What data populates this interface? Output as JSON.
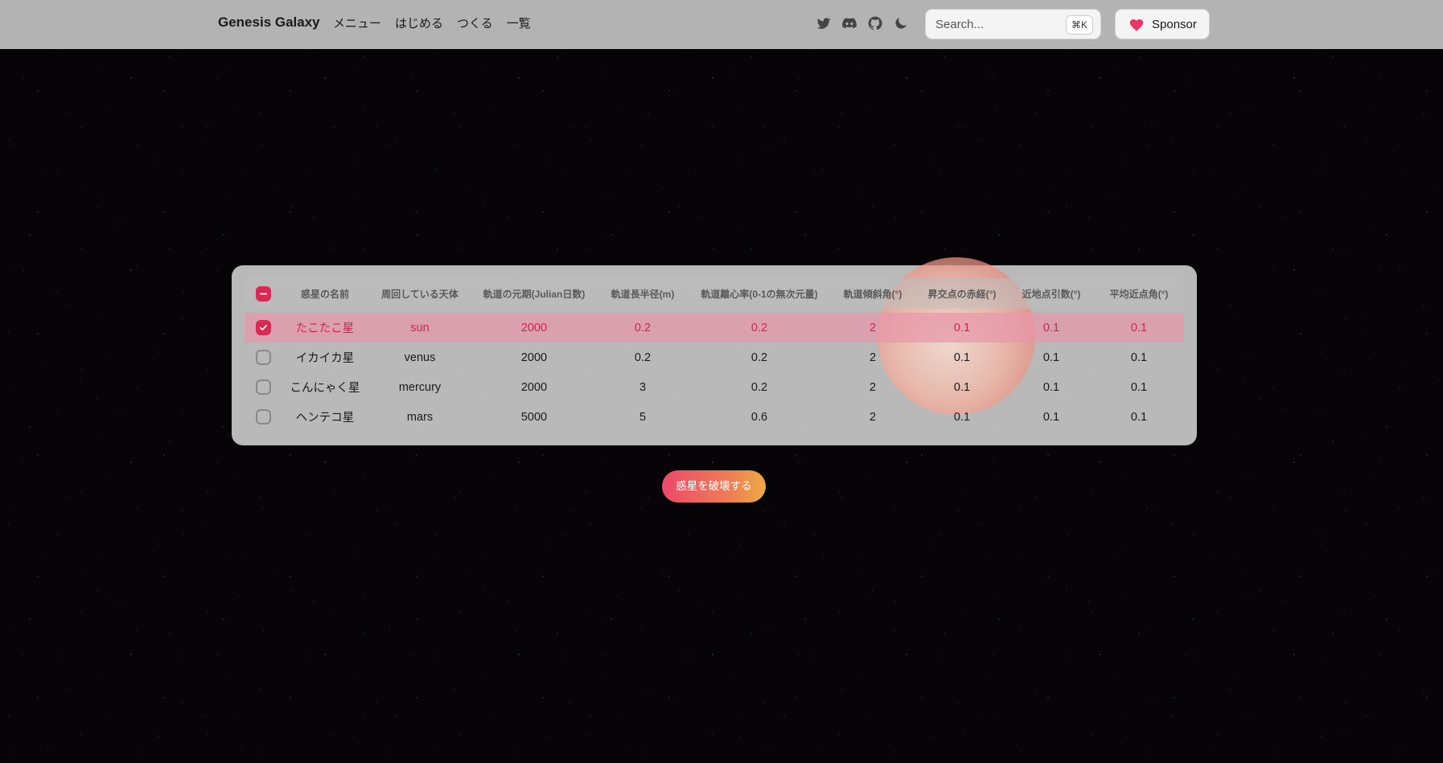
{
  "navbar": {
    "brand": "Genesis Galaxy",
    "links": [
      "メニュー",
      "はじめる",
      "つくる",
      "一覧"
    ],
    "icons": [
      "twitter-icon",
      "discord-icon",
      "github-icon",
      "moon-icon"
    ],
    "search_placeholder": "Search...",
    "search_shortcut": "⌘K",
    "sponsor_label": "Sponsor"
  },
  "table": {
    "headers": [
      "惑星の名前",
      "周回している天体",
      "軌道の元期(Julian日数)",
      "軌道長半径(m)",
      "軌道離心率(0-1の無次元量)",
      "軌道傾斜角(°)",
      "昇交点の赤経(°)",
      "近地点引数(°)",
      "平均近点角(°)"
    ],
    "rows": [
      {
        "selected": true,
        "cells": [
          "たこたこ星",
          "sun",
          "2000",
          "0.2",
          "0.2",
          "2",
          "0.1",
          "0.1",
          "0.1"
        ]
      },
      {
        "selected": false,
        "cells": [
          "イカイカ星",
          "venus",
          "2000",
          "0.2",
          "0.2",
          "2",
          "0.1",
          "0.1",
          "0.1"
        ]
      },
      {
        "selected": false,
        "cells": [
          "こんにゃく星",
          "mercury",
          "2000",
          "3",
          "0.2",
          "2",
          "0.1",
          "0.1",
          "0.1"
        ]
      },
      {
        "selected": false,
        "cells": [
          "ヘンテコ星",
          "mars",
          "5000",
          "5",
          "0.6",
          "2",
          "0.1",
          "0.1",
          "0.1"
        ]
      }
    ]
  },
  "actions": {
    "destroy_label": "惑星を破壊する"
  },
  "colors": {
    "accent": "#d92a56",
    "navbar": "#b3b3b3",
    "button_gradient_start": "#ec4a6a",
    "button_gradient_end": "#eeaa44"
  }
}
